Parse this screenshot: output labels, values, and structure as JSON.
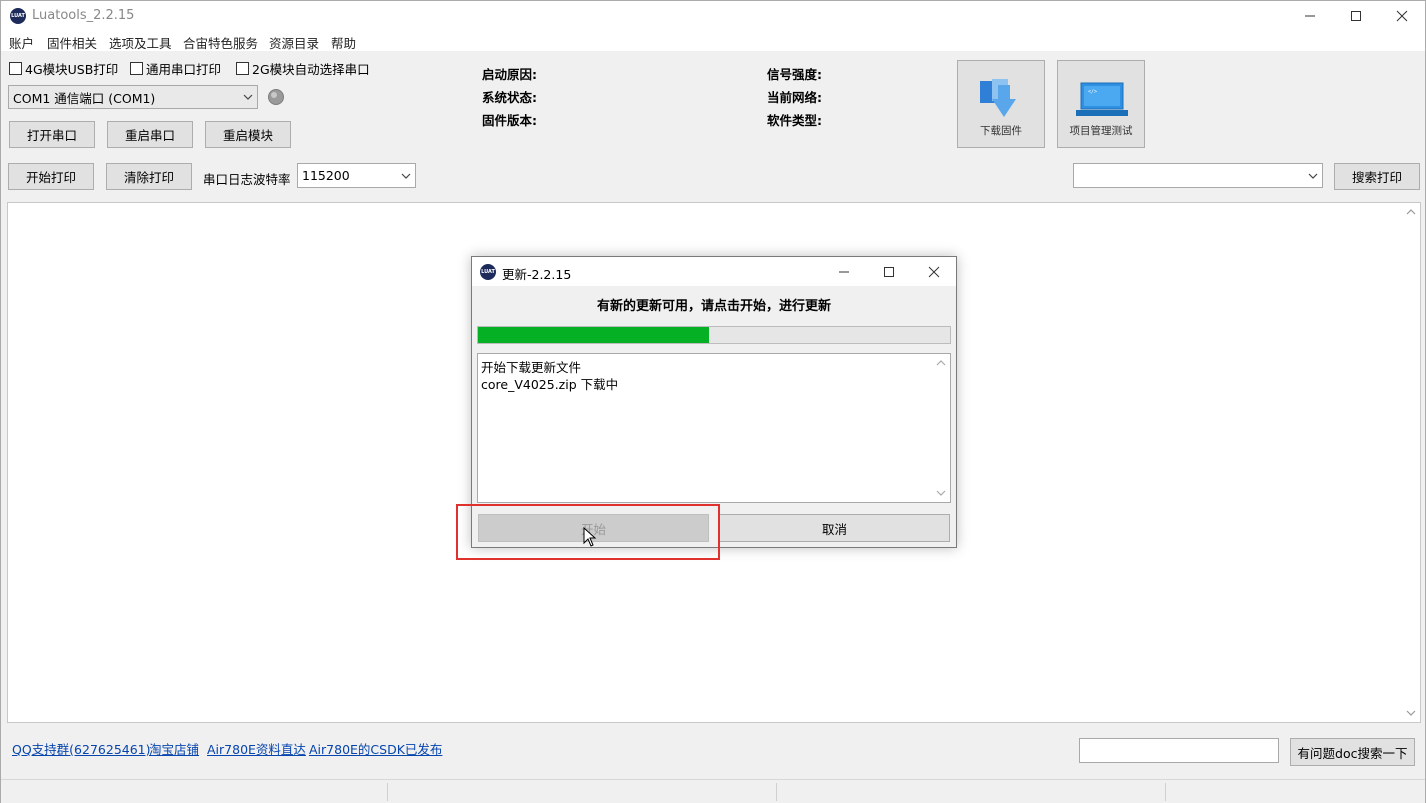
{
  "window": {
    "title": "Luatools_2.2.15",
    "logo_text": "LUAT"
  },
  "menu": [
    "账户",
    "固件相关",
    "选项及工具",
    "合宙特色服务",
    "资源目录",
    "帮助"
  ],
  "checkboxes": [
    {
      "label": "4G模块USB打印",
      "checked": false
    },
    {
      "label": "通用串口打印",
      "checked": false
    },
    {
      "label": "2G模块自动选择串口",
      "checked": false
    }
  ],
  "port": {
    "selected": "COM1 通信端口 (COM1)",
    "status_indicator": "gray"
  },
  "buttons": {
    "open_port": "打开串口",
    "restart_port": "重启串口",
    "restart_module": "重启模块",
    "start_print": "开始打印",
    "clear_print": "清除打印",
    "search_print": "搜索打印",
    "download_firmware": "下载固件",
    "project_test": "项目管理测试",
    "doc_search": "有问题doc搜索一下"
  },
  "baud": {
    "label": "串口日志波特率",
    "value": "115200"
  },
  "info": {
    "boot_reason": "启动原因:",
    "system_status": "系统状态:",
    "firmware_version": "固件版本:",
    "signal_strength": "信号强度:",
    "current_network": "当前网络:",
    "software_type": "软件类型:"
  },
  "search": {
    "value": "",
    "doc_search_value": ""
  },
  "links": [
    "QQ支持群(627625461)",
    "淘宝店铺",
    "Air780E资料直达",
    "Air780E的CSDK已发布"
  ],
  "dialog": {
    "title": "更新-2.2.15",
    "message": "有新的更新可用，请点击开始，进行更新",
    "progress": 0.49,
    "log": [
      "开始下载更新文件",
      "core_V4025.zip 下载中"
    ],
    "start_label": "开始",
    "start_enabled": false,
    "cancel_label": "取消"
  },
  "colors": {
    "progress_fill": "#06b025",
    "link": "#0645ad",
    "highlight": "#e0312f",
    "logo": "#1c2b5a"
  }
}
